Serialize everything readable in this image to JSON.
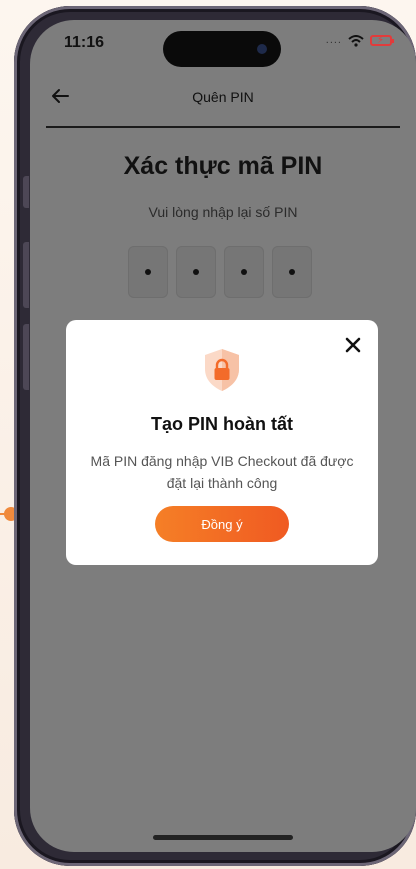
{
  "status_bar": {
    "time": "11:16",
    "signal": "....",
    "icons": [
      "wifi-icon",
      "battery-charging-icon"
    ],
    "battery_color": "#e23b3b"
  },
  "nav": {
    "title": "Quên PIN",
    "back_icon": "arrow-left-icon"
  },
  "page": {
    "heading": "Xác thực mã PIN",
    "subheading": "Vui lòng nhập lại số PIN",
    "pin_dots": [
      "•",
      "•",
      "•",
      "•"
    ]
  },
  "modal": {
    "close_icon": "close-icon",
    "icon": "shield-lock-icon",
    "title": "Tạo PIN hoàn tất",
    "message": "Mã PIN đăng nhập VIB Checkout đã được đặt lại thành công",
    "confirm_label": "Đồng ý"
  },
  "colors": {
    "accent": "#f57f26",
    "accent_dark": "#f05a22",
    "overlay": "#7d7d7d"
  }
}
